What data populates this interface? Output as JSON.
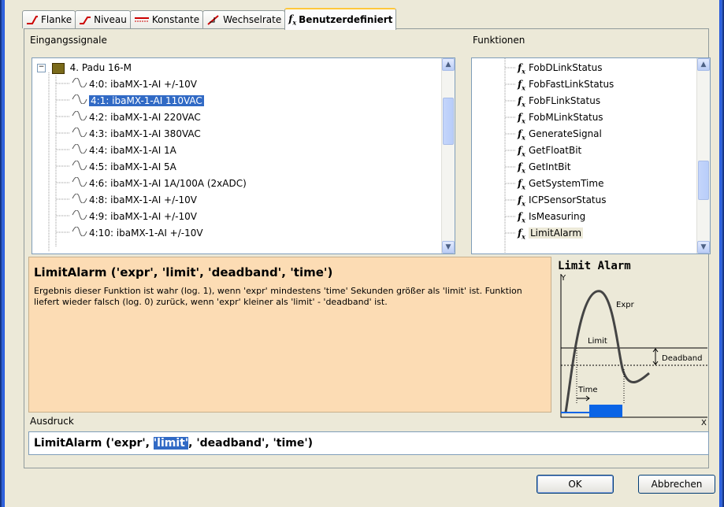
{
  "tabs": [
    {
      "label": "Flanke",
      "icon": "edge-icon"
    },
    {
      "label": "Niveau",
      "icon": "level-icon"
    },
    {
      "label": "Konstante",
      "icon": "constant-icon"
    },
    {
      "label": "Wechselrate",
      "icon": "rate-icon"
    },
    {
      "label": "Benutzerdefiniert",
      "icon": "fx-icon"
    }
  ],
  "signals": {
    "header": "Eingangssignale",
    "root": "4. Padu 16-M",
    "items": [
      "4:0: ibaMX-1-AI +/-10V",
      "4:1: ibaMX-1-AI 110VAC",
      "4:2: ibaMX-1-AI 220VAC",
      "4:3: ibaMX-1-AI 380VAC",
      "4:4: ibaMX-1-AI 1A",
      "4:5: ibaMX-1-AI 5A",
      "4:6: ibaMX-1-AI 1A/100A (2xADC)",
      "4:8: ibaMX-1-AI +/-10V",
      "4:9: ibaMX-1-AI +/-10V",
      "4:10: ibaMX-1-AI +/-10V"
    ],
    "selected_index": 1
  },
  "functions": {
    "header": "Funktionen",
    "items": [
      "FobDLinkStatus",
      "FobFastLinkStatus",
      "FobFLinkStatus",
      "FobMLinkStatus",
      "GenerateSignal",
      "GetFloatBit",
      "GetIntBit",
      "GetSystemTime",
      "ICPSensorStatus",
      "IsMeasuring",
      "LimitAlarm"
    ],
    "highlighted": "LimitAlarm"
  },
  "description": {
    "title": "LimitAlarm ('expr', 'limit', 'deadband', 'time')",
    "text": "Ergebnis dieser Funktion ist wahr (log. 1), wenn 'expr' mindestens 'time' Sekunden größer als 'limit' ist. Funktion liefert wieder falsch (log. 0) zurück, wenn 'expr' kleiner als 'limit' - 'deadband' ist."
  },
  "diagram": {
    "title": "Limit Alarm",
    "y_label": "Y",
    "x_label": "X",
    "expr_label": "Expr",
    "limit_label": "Limit",
    "deadband_label": "Deadband",
    "time_label": "Time"
  },
  "expression": {
    "label": "Ausdruck",
    "before": "LimitAlarm ('expr', ",
    "selected": "'limit'",
    "after": ", 'deadband', 'time')"
  },
  "buttons": {
    "ok": "OK",
    "cancel": "Abbrechen"
  }
}
